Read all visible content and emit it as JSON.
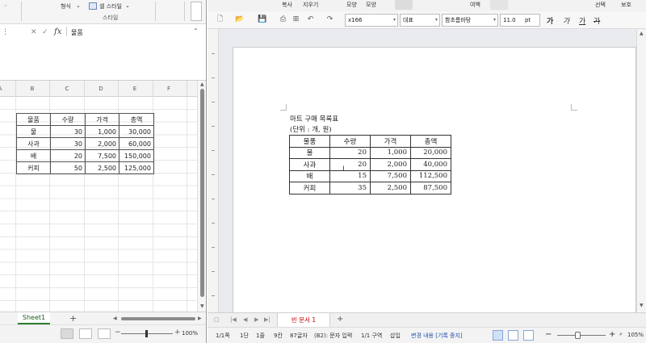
{
  "excel": {
    "ribbon": {
      "format_label": "형식",
      "cell_style_label": "셀 스타일",
      "group_label": "스타일"
    },
    "formula_bar": {
      "fx": "fx",
      "cancel": "✕",
      "confirm": "✓",
      "value": "물품"
    },
    "columns": [
      "A",
      "B",
      "C",
      "D",
      "E",
      "F"
    ],
    "table": {
      "headers": [
        "물품",
        "수량",
        "가격",
        "총액"
      ],
      "rows": [
        [
          "물",
          "30",
          "1,000",
          "30,000"
        ],
        [
          "사과",
          "30",
          "2,000",
          "60,000"
        ],
        [
          "배",
          "20",
          "7,500",
          "150,000"
        ],
        [
          "커피",
          "50",
          "2,500",
          "125,000"
        ]
      ]
    },
    "sheet_tab": "Sheet1",
    "add_sheet": "+",
    "zoom": "100%",
    "zoom_minus": "−",
    "zoom_plus": "+"
  },
  "hwp": {
    "menu": {
      "copy": "복사",
      "erase": "지우기",
      "shape": "모양",
      "shape2": "모양",
      "margin": "여백",
      "select": "선택",
      "protect": "보호"
    },
    "toolbar": {
      "style": "x166",
      "category": "대표",
      "font": "함초롬바탕",
      "size": "11.0",
      "unit": "pt",
      "bold": "가",
      "italic": "가",
      "underline": "가",
      "strike": "가"
    },
    "document": {
      "title": "마트 구매 목록표",
      "unit": "(단위 : 개, 원)",
      "table": {
        "headers": [
          "물품",
          "수량",
          "가격",
          "총액"
        ],
        "rows": [
          [
            "물",
            "20",
            "1,000",
            "20,000"
          ],
          [
            "사과",
            "20",
            "2,000",
            "40,000"
          ],
          [
            "배",
            "15",
            "7,500",
            "112,500"
          ],
          [
            "커피",
            "35",
            "2,500",
            "87,500"
          ]
        ]
      }
    },
    "doc_tab": "빈 문서 1",
    "add_tab": "+",
    "status": {
      "page": "1/1쪽",
      "section": "1단",
      "line": "1줄",
      "column": "9칸",
      "chars": "87글자",
      "input_mode": "(B2): 문자 입력",
      "zone": "1/1 구역",
      "insert": "삽입",
      "track": "변경 내용 [기록 중지]",
      "zoom": "105%"
    }
  }
}
